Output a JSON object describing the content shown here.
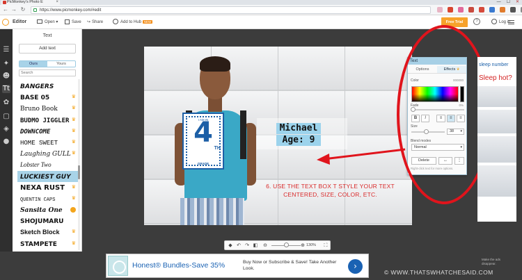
{
  "browser": {
    "tab_title": "PicMonkey's Photo E",
    "tab_close": "×",
    "url": "https://www.picmonkey.com/#edit",
    "win_min": "—",
    "win_max": "☐",
    "win_close": "✕"
  },
  "topbar": {
    "editor": "Editor",
    "open": "Open ▾",
    "save": "Save",
    "share": "Share",
    "hub": "Add to Hub",
    "hub_badge": "NEW",
    "free_trial": "Free Trial",
    "login": "Log in"
  },
  "text_panel": {
    "title": "Text",
    "add_text": "Add text",
    "tab_ours": "Ours",
    "tab_yours": "Yours",
    "search_placeholder": "Search",
    "fonts": [
      {
        "name": "BANGERS",
        "premium": false
      },
      {
        "name": "BASE 05",
        "premium": true
      },
      {
        "name": "Bruno Book",
        "premium": true
      },
      {
        "name": "BUDMO JIGGLER",
        "premium": true
      },
      {
        "name": "DOWNCOME",
        "premium": true
      },
      {
        "name": "HOME SWEET",
        "premium": true
      },
      {
        "name": "Laughing GULL",
        "premium": true
      },
      {
        "name": "Lobster Two",
        "premium": false
      },
      {
        "name": "LUCKIEST GUY",
        "premium": false
      },
      {
        "name": "NEXA RUST",
        "premium": true
      },
      {
        "name": "QUENTIN CAPS",
        "premium": true
      },
      {
        "name": "Sansita One",
        "premium": true
      },
      {
        "name": "SHOJUMARU",
        "premium": false
      },
      {
        "name": "Sketch Block",
        "premium": true
      },
      {
        "name": "STAMPETE",
        "premium": true
      }
    ],
    "selected_font": "LUCKIEST GUY"
  },
  "canvas": {
    "sign_top": "I AM IN",
    "sign_number": "4",
    "sign_suffix": "TH",
    "sign_bottom": "GRADE",
    "name_text": "Michael",
    "age_text": "Age: 9",
    "instruction": "6. USE THE TEXT BOX T STYLE YOUR TEXT CENTERED, SIZE, COLOR, ETC."
  },
  "text_props": {
    "title": "Text",
    "tab_options": "Options",
    "tab_effects": "Effects",
    "color_label": "Color",
    "color_value": "000000",
    "fade_label": "Fade",
    "fade_value": "0%",
    "bold": "B",
    "italic": "I",
    "size_label": "Size",
    "size_value": "38",
    "blend_label": "Blend modes",
    "blend_value": "Normal",
    "delete": "Delete",
    "flip": "↔",
    "more": "⋮",
    "hint": "Right-click text for more options."
  },
  "ad_right": {
    "brand": "sleep number",
    "headline": "Sleep hot?"
  },
  "zoom": {
    "value": "130%"
  },
  "ad_bottom": {
    "headline": "Honest® Bundles-Save 35%",
    "body": "Buy Now or Subscribe & Save! Take Another Look.",
    "go": "›",
    "ad_choices": "Make the ads disappear."
  },
  "watermark": "© WWW.THATSWHATCHESAID.COM",
  "colors": {
    "accent_orange": "#f7a22a",
    "selection_blue": "#a8d3e8",
    "annotation_red": "#e0141c",
    "link_blue": "#1a62b3"
  }
}
